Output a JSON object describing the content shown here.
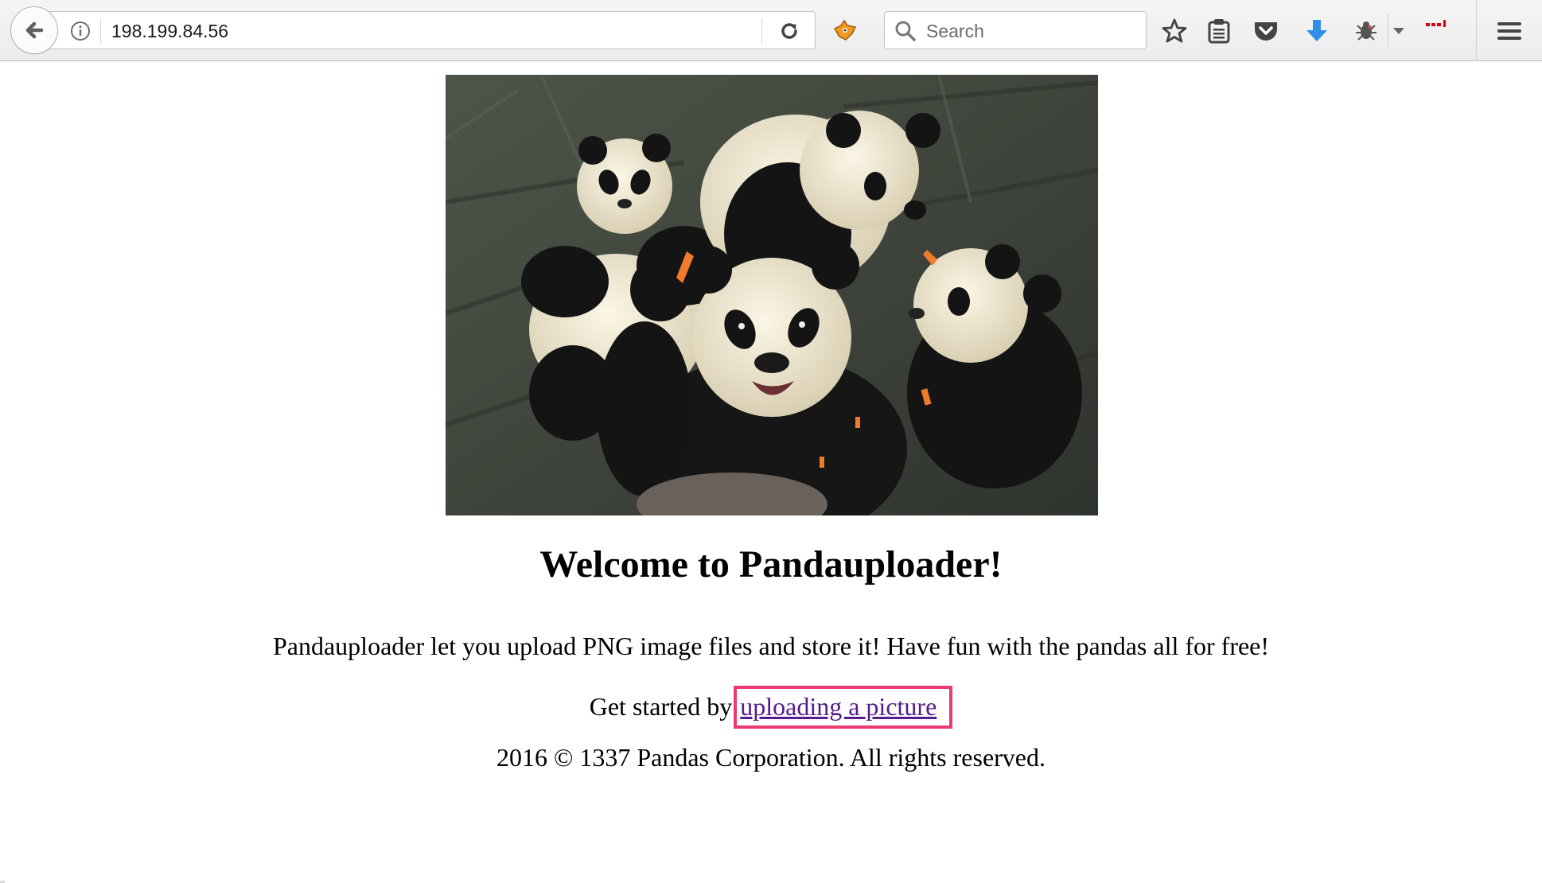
{
  "browser": {
    "address_bar": {
      "url": "198.199.84.56"
    },
    "search_bar": {
      "placeholder": "Search"
    },
    "icons": {
      "back": "back-arrow-icon",
      "site_info": "info-icon",
      "reload": "reload-icon",
      "extension": "fox-extension-icon",
      "search": "search-icon",
      "bookmark": "star-icon",
      "reading_list": "clipboard-icon",
      "pocket": "pocket-icon",
      "downloads": "download-arrow-icon",
      "bug": "bug-icon",
      "dropdown": "chevron-down-icon",
      "more": "more-dots-icon",
      "menu": "hamburger-menu-icon"
    },
    "colors": {
      "download_arrow": "#2f8fe8",
      "more_dots": "#d0021b"
    }
  },
  "page": {
    "hero_image_alt": "photo of four giant pandas",
    "title": "Welcome to Pandauploader!",
    "description": "Pandauploader let you upload PNG image files and store it! Have fun with the pandas all for free!",
    "cta_prefix": "Get started by",
    "cta_link": "uploading a picture",
    "footer": "2016 © 1337 Pandas Corporation. All rights reserved.",
    "colors": {
      "link": "#551a8b",
      "highlight_box": "#ec3a73"
    }
  }
}
